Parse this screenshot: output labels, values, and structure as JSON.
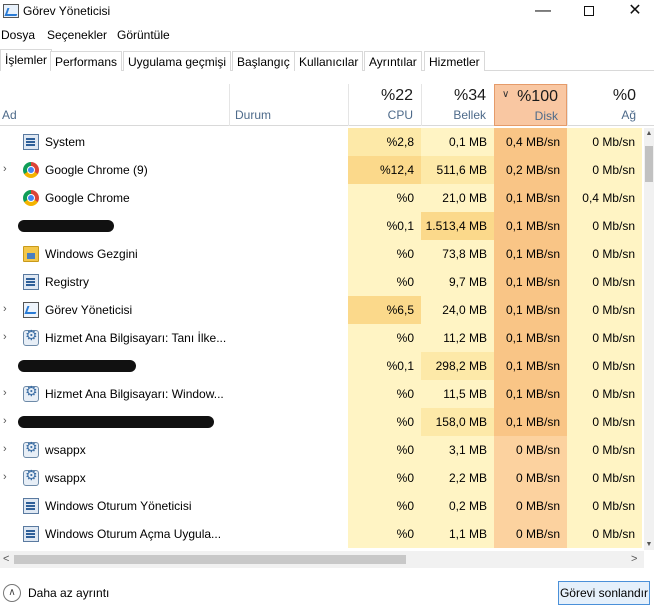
{
  "window": {
    "title": "Görev Yöneticisi",
    "min_glyph": "—",
    "close_glyph": "✕"
  },
  "menu": [
    "Dosya",
    "Seçenekler",
    "Görüntüle"
  ],
  "tabs": [
    "İşlemler",
    "Performans",
    "Uygulama geçmişi",
    "Başlangıç",
    "Kullanıcılar",
    "Ayrıntılar",
    "Hizmetler"
  ],
  "columns": {
    "name": "Ad",
    "status": "Durum",
    "cpu": {
      "pct": "%22",
      "label": "CPU"
    },
    "memory": {
      "pct": "%34",
      "label": "Bellek"
    },
    "disk": {
      "pct": "%100",
      "label": "Disk"
    },
    "network": {
      "pct": "%0",
      "label": "Ağ"
    }
  },
  "processes": [
    {
      "name": "System",
      "icon": "system-icon",
      "expandable": false,
      "cpu": "%2,8",
      "mem": "0,1 MB",
      "disk": "0,4 MB/sn",
      "net": "0 Mb/sn"
    },
    {
      "name": "Google Chrome (9)",
      "icon": "chrome-icon",
      "expandable": true,
      "cpu": "%12,4",
      "mem": "511,6 MB",
      "disk": "0,2 MB/sn",
      "net": "0 Mb/sn"
    },
    {
      "name": "Google Chrome",
      "icon": "chrome-icon",
      "expandable": false,
      "cpu": "%0",
      "mem": "21,0 MB",
      "disk": "0,1 MB/sn",
      "net": "0,4 Mb/sn"
    },
    {
      "name": "",
      "icon": "",
      "expandable": false,
      "redacted": true,
      "cpu": "%0,1",
      "mem": "1.513,4 MB",
      "disk": "0,1 MB/sn",
      "net": "0 Mb/sn"
    },
    {
      "name": "Windows Gezgini",
      "icon": "folder-icon",
      "expandable": false,
      "cpu": "%0",
      "mem": "73,8 MB",
      "disk": "0,1 MB/sn",
      "net": "0 Mb/sn"
    },
    {
      "name": "Registry",
      "icon": "system-icon",
      "expandable": false,
      "cpu": "%0",
      "mem": "9,7 MB",
      "disk": "0,1 MB/sn",
      "net": "0 Mb/sn"
    },
    {
      "name": "Görev Yöneticisi",
      "icon": "task-manager-icon",
      "expandable": true,
      "cpu": "%6,5",
      "mem": "24,0 MB",
      "disk": "0,1 MB/sn",
      "net": "0 Mb/sn"
    },
    {
      "name": "Hizmet Ana Bilgisayarı: Tanı İlke...",
      "icon": "gear-icon",
      "expandable": true,
      "cpu": "%0",
      "mem": "11,2 MB",
      "disk": "0,1 MB/sn",
      "net": "0 Mb/sn"
    },
    {
      "name": "",
      "icon": "",
      "expandable": false,
      "redacted": true,
      "cpu": "%0,1",
      "mem": "298,2 MB",
      "disk": "0,1 MB/sn",
      "net": "0 Mb/sn"
    },
    {
      "name": "Hizmet Ana Bilgisayarı: Window...",
      "icon": "gear-icon",
      "expandable": true,
      "cpu": "%0",
      "mem": "11,5 MB",
      "disk": "0,1 MB/sn",
      "net": "0 Mb/sn"
    },
    {
      "name": "",
      "icon": "",
      "expandable": true,
      "redacted": true,
      "cpu": "%0",
      "mem": "158,0 MB",
      "disk": "0,1 MB/sn",
      "net": "0 Mb/sn"
    },
    {
      "name": "wsappx",
      "icon": "gear-icon",
      "expandable": true,
      "cpu": "%0",
      "mem": "3,1 MB",
      "disk": "0 MB/sn",
      "net": "0 Mb/sn"
    },
    {
      "name": "wsappx",
      "icon": "gear-icon",
      "expandable": true,
      "cpu": "%0",
      "mem": "2,2 MB",
      "disk": "0 MB/sn",
      "net": "0 Mb/sn"
    },
    {
      "name": "Windows Oturum Yöneticisi",
      "icon": "system-icon",
      "expandable": false,
      "cpu": "%0",
      "mem": "0,2 MB",
      "disk": "0 MB/sn",
      "net": "0 Mb/sn"
    },
    {
      "name": "Windows Oturum Açma Uygula...",
      "icon": "system-icon",
      "expandable": false,
      "cpu": "%0",
      "mem": "1,1 MB",
      "disk": "0 MB/sn",
      "net": "0 Mb/sn"
    }
  ],
  "footer": {
    "fewer_details": "Daha az ayrıntı",
    "end_task": "Görevi sonlandır"
  },
  "colors": {
    "heat_light": "#fff4c4",
    "heat_mid": "#fde9a8",
    "heat_strong": "#fbd98b",
    "disk_column": "#fcd29f",
    "disk_strong": "#f9c586"
  }
}
